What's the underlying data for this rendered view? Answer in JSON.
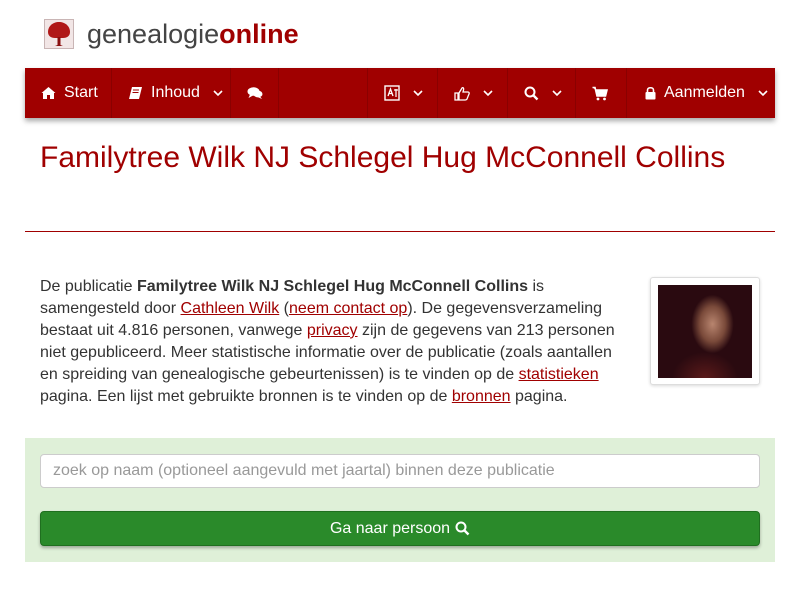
{
  "brand": {
    "name_regular": "genealogie",
    "name_bold": "online"
  },
  "colors": {
    "brand_red": "#a00000",
    "panel_green": "#dff0d8",
    "button_green": "#2a8a2a"
  },
  "nav": {
    "items": [
      {
        "label": "Start",
        "icon": "home-icon"
      },
      {
        "label": "Inhoud",
        "icon": "book-icon",
        "has_dropdown": true
      },
      {
        "label": "",
        "icon": "comments-icon"
      },
      {
        "label": "",
        "icon": "translate-icon",
        "has_dropdown": true
      },
      {
        "label": "",
        "icon": "thumbs-up-icon",
        "has_dropdown": true
      },
      {
        "label": "",
        "icon": "search-icon",
        "has_dropdown": true
      },
      {
        "label": "",
        "icon": "cart-icon"
      },
      {
        "label": "Aanmelden",
        "icon": "lock-icon",
        "has_dropdown": true
      }
    ]
  },
  "title": "Familytree Wilk NJ Schlegel Hug McConnell Collins",
  "intro": {
    "t1": "De publicatie ",
    "pub_name": "Familytree Wilk NJ Schlegel Hug McConnell Collins",
    "t2": " is samengesteld door ",
    "author": "Cathleen Wilk",
    "t3": " (",
    "contact": "neem contact op",
    "t4": "). De gegevensverzameling bestaat uit 4.816 personen, vanwege ",
    "privacy": "privacy",
    "t5": " zijn de gegevens van 213 personen niet gepubliceerd. Meer statistische informatie over de publicatie (zoals aantallen en spreiding van genealogische gebeurtenissen) is te vinden op de ",
    "statistics": "statistieken",
    "t6": " pagina. Een lijst met gebruikte bronnen is te vinden op de ",
    "sources": "bronnen",
    "t7": " pagina."
  },
  "photo": {
    "icon": "author-photo"
  },
  "search": {
    "placeholder": "zoek op naam (optioneel aangevuld met jaartal) binnen deze publicatie",
    "value": "",
    "button_label": "Ga naar persoon"
  }
}
